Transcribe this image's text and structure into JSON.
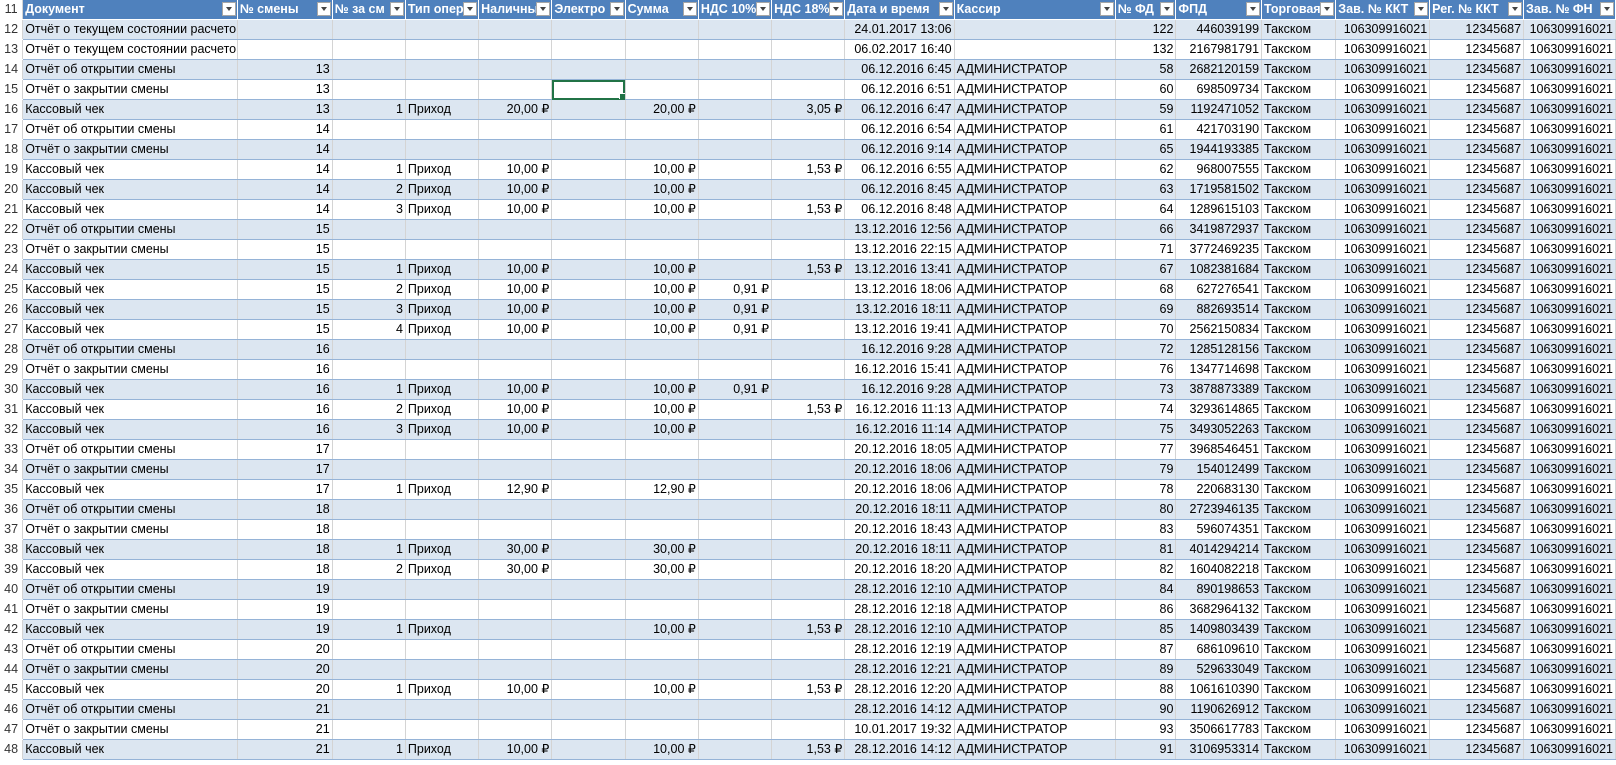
{
  "columns": [
    {
      "label": "Документ",
      "filter_icon": "filter-dropdown-icon"
    },
    {
      "label": "№ смены",
      "filter_icon": "filter-dropdown-icon"
    },
    {
      "label": "№ за см",
      "filter_icon": "filter-dropdown-icon"
    },
    {
      "label": "Тип опер",
      "filter_icon": "filter-dropdown-icon"
    },
    {
      "label": "Наличны",
      "filter_icon": "filter-dropdown-icon"
    },
    {
      "label": "Электро",
      "filter_icon": "filter-dropdown-icon"
    },
    {
      "label": "Сумма",
      "filter_icon": "filter-dropdown-icon"
    },
    {
      "label": "НДС 10%",
      "filter_icon": "filter-dropdown-icon"
    },
    {
      "label": "НДС 18%",
      "filter_icon": "filter-dropdown-icon"
    },
    {
      "label": "Дата и время",
      "filter_icon": "filter-dropdown-icon"
    },
    {
      "label": "Кассир",
      "filter_icon": "filter-dropdown-icon"
    },
    {
      "label": "№ ФД",
      "filter_icon": "filter-dropdown-icon"
    },
    {
      "label": "ФПД",
      "filter_icon": "filter-dropdown-icon"
    },
    {
      "label": "Торговая",
      "filter_icon": "filter-dropdown-icon"
    },
    {
      "label": "Зав. № ККТ",
      "filter_icon": "filter-dropdown-icon"
    },
    {
      "label": "Рег. № ККТ",
      "filter_icon": "filter-dropdown-icon"
    },
    {
      "label": "Зав. № ФН",
      "filter_icon": "filter-dropdown-icon"
    }
  ],
  "header_row_number": "11",
  "selected_cell": {
    "row": "15",
    "column": "Электро"
  },
  "colors": {
    "header_bg": "#4f81bd",
    "band_bg": "#dce6f1",
    "selection": "#217346"
  },
  "rows": [
    {
      "n": "12",
      "cells": [
        "Отчёт о текущем состоянии расчетов",
        "",
        "",
        "",
        "",
        "",
        "",
        "",
        "",
        "24.01.2017 13:06",
        "",
        "122",
        "446039199",
        "Такском",
        "106309916021",
        "12345687",
        "106309916021"
      ]
    },
    {
      "n": "13",
      "cells": [
        "Отчёт о текущем состоянии расчетов",
        "",
        "",
        "",
        "",
        "",
        "",
        "",
        "",
        "06.02.2017 16:40",
        "",
        "132",
        "2167981791",
        "Такском",
        "106309916021",
        "12345687",
        "106309916021"
      ]
    },
    {
      "n": "14",
      "cells": [
        "Отчёт об открытии смены",
        "13",
        "",
        "",
        "",
        "",
        "",
        "",
        "",
        "06.12.2016 6:45",
        "АДМИНИСТРАТОР",
        "58",
        "2682120159",
        "Такском",
        "106309916021",
        "12345687",
        "106309916021"
      ]
    },
    {
      "n": "15",
      "cells": [
        "Отчёт о закрытии смены",
        "13",
        "",
        "",
        "",
        "",
        "",
        "",
        "",
        "06.12.2016 6:51",
        "АДМИНИСТРАТОР",
        "60",
        "698509734",
        "Такском",
        "106309916021",
        "12345687",
        "106309916021"
      ]
    },
    {
      "n": "16",
      "cells": [
        "Кассовый чек",
        "13",
        "1",
        "Приход",
        "20,00 ₽",
        "",
        "20,00 ₽",
        "",
        "3,05 ₽",
        "06.12.2016 6:47",
        "АДМИНИСТРАТОР",
        "59",
        "1192471052",
        "Такском",
        "106309916021",
        "12345687",
        "106309916021"
      ]
    },
    {
      "n": "17",
      "cells": [
        "Отчёт об открытии смены",
        "14",
        "",
        "",
        "",
        "",
        "",
        "",
        "",
        "06.12.2016 6:54",
        "АДМИНИСТРАТОР",
        "61",
        "421703190",
        "Такском",
        "106309916021",
        "12345687",
        "106309916021"
      ]
    },
    {
      "n": "18",
      "cells": [
        "Отчёт о закрытии смены",
        "14",
        "",
        "",
        "",
        "",
        "",
        "",
        "",
        "06.12.2016 9:14",
        "АДМИНИСТРАТОР",
        "65",
        "1944193385",
        "Такском",
        "106309916021",
        "12345687",
        "106309916021"
      ]
    },
    {
      "n": "19",
      "cells": [
        "Кассовый чек",
        "14",
        "1",
        "Приход",
        "10,00 ₽",
        "",
        "10,00 ₽",
        "",
        "1,53 ₽",
        "06.12.2016 6:55",
        "АДМИНИСТРАТОР",
        "62",
        "968007555",
        "Такском",
        "106309916021",
        "12345687",
        "106309916021"
      ]
    },
    {
      "n": "20",
      "cells": [
        "Кассовый чек",
        "14",
        "2",
        "Приход",
        "10,00 ₽",
        "",
        "10,00 ₽",
        "",
        "",
        "06.12.2016 8:45",
        "АДМИНИСТРАТОР",
        "63",
        "1719581502",
        "Такском",
        "106309916021",
        "12345687",
        "106309916021"
      ]
    },
    {
      "n": "21",
      "cells": [
        "Кассовый чек",
        "14",
        "3",
        "Приход",
        "10,00 ₽",
        "",
        "10,00 ₽",
        "",
        "1,53 ₽",
        "06.12.2016 8:48",
        "АДМИНИСТРАТОР",
        "64",
        "1289615103",
        "Такском",
        "106309916021",
        "12345687",
        "106309916021"
      ]
    },
    {
      "n": "22",
      "cells": [
        "Отчёт об открытии смены",
        "15",
        "",
        "",
        "",
        "",
        "",
        "",
        "",
        "13.12.2016 12:56",
        "АДМИНИСТРАТОР",
        "66",
        "3419872937",
        "Такском",
        "106309916021",
        "12345687",
        "106309916021"
      ]
    },
    {
      "n": "23",
      "cells": [
        "Отчёт о закрытии смены",
        "15",
        "",
        "",
        "",
        "",
        "",
        "",
        "",
        "13.12.2016 22:15",
        "АДМИНИСТРАТОР",
        "71",
        "3772469235",
        "Такском",
        "106309916021",
        "12345687",
        "106309916021"
      ]
    },
    {
      "n": "24",
      "cells": [
        "Кассовый чек",
        "15",
        "1",
        "Приход",
        "10,00 ₽",
        "",
        "10,00 ₽",
        "",
        "1,53 ₽",
        "13.12.2016 13:41",
        "АДМИНИСТРАТОР",
        "67",
        "1082381684",
        "Такском",
        "106309916021",
        "12345687",
        "106309916021"
      ]
    },
    {
      "n": "25",
      "cells": [
        "Кассовый чек",
        "15",
        "2",
        "Приход",
        "10,00 ₽",
        "",
        "10,00 ₽",
        "0,91 ₽",
        "",
        "13.12.2016 18:06",
        "АДМИНИСТРАТОР",
        "68",
        "627276541",
        "Такском",
        "106309916021",
        "12345687",
        "106309916021"
      ]
    },
    {
      "n": "26",
      "cells": [
        "Кассовый чек",
        "15",
        "3",
        "Приход",
        "10,00 ₽",
        "",
        "10,00 ₽",
        "0,91 ₽",
        "",
        "13.12.2016 18:11",
        "АДМИНИСТРАТОР",
        "69",
        "882693514",
        "Такском",
        "106309916021",
        "12345687",
        "106309916021"
      ]
    },
    {
      "n": "27",
      "cells": [
        "Кассовый чек",
        "15",
        "4",
        "Приход",
        "10,00 ₽",
        "",
        "10,00 ₽",
        "0,91 ₽",
        "",
        "13.12.2016 19:41",
        "АДМИНИСТРАТОР",
        "70",
        "2562150834",
        "Такском",
        "106309916021",
        "12345687",
        "106309916021"
      ]
    },
    {
      "n": "28",
      "cells": [
        "Отчёт об открытии смены",
        "16",
        "",
        "",
        "",
        "",
        "",
        "",
        "",
        "16.12.2016 9:28",
        "АДМИНИСТРАТОР",
        "72",
        "1285128156",
        "Такском",
        "106309916021",
        "12345687",
        "106309916021"
      ]
    },
    {
      "n": "29",
      "cells": [
        "Отчёт о закрытии смены",
        "16",
        "",
        "",
        "",
        "",
        "",
        "",
        "",
        "16.12.2016 15:41",
        "АДМИНИСТРАТОР",
        "76",
        "1347714698",
        "Такском",
        "106309916021",
        "12345687",
        "106309916021"
      ]
    },
    {
      "n": "30",
      "cells": [
        "Кассовый чек",
        "16",
        "1",
        "Приход",
        "10,00 ₽",
        "",
        "10,00 ₽",
        "0,91 ₽",
        "",
        "16.12.2016 9:28",
        "АДМИНИСТРАТОР",
        "73",
        "3878873389",
        "Такском",
        "106309916021",
        "12345687",
        "106309916021"
      ]
    },
    {
      "n": "31",
      "cells": [
        "Кассовый чек",
        "16",
        "2",
        "Приход",
        "10,00 ₽",
        "",
        "10,00 ₽",
        "",
        "1,53 ₽",
        "16.12.2016 11:13",
        "АДМИНИСТРАТОР",
        "74",
        "3293614865",
        "Такском",
        "106309916021",
        "12345687",
        "106309916021"
      ]
    },
    {
      "n": "32",
      "cells": [
        "Кассовый чек",
        "16",
        "3",
        "Приход",
        "10,00 ₽",
        "",
        "10,00 ₽",
        "",
        "",
        "16.12.2016 11:14",
        "АДМИНИСТРАТОР",
        "75",
        "3493052263",
        "Такском",
        "106309916021",
        "12345687",
        "106309916021"
      ]
    },
    {
      "n": "33",
      "cells": [
        "Отчёт об открытии смены",
        "17",
        "",
        "",
        "",
        "",
        "",
        "",
        "",
        "20.12.2016 18:05",
        "АДМИНИСТРАТОР",
        "77",
        "3968546451",
        "Такском",
        "106309916021",
        "12345687",
        "106309916021"
      ]
    },
    {
      "n": "34",
      "cells": [
        "Отчёт о закрытии смены",
        "17",
        "",
        "",
        "",
        "",
        "",
        "",
        "",
        "20.12.2016 18:06",
        "АДМИНИСТРАТОР",
        "79",
        "154012499",
        "Такском",
        "106309916021",
        "12345687",
        "106309916021"
      ]
    },
    {
      "n": "35",
      "cells": [
        "Кассовый чек",
        "17",
        "1",
        "Приход",
        "12,90 ₽",
        "",
        "12,90 ₽",
        "",
        "",
        "20.12.2016 18:06",
        "АДМИНИСТРАТОР",
        "78",
        "220683130",
        "Такском",
        "106309916021",
        "12345687",
        "106309916021"
      ]
    },
    {
      "n": "36",
      "cells": [
        "Отчёт об открытии смены",
        "18",
        "",
        "",
        "",
        "",
        "",
        "",
        "",
        "20.12.2016 18:11",
        "АДМИНИСТРАТОР",
        "80",
        "2723946135",
        "Такском",
        "106309916021",
        "12345687",
        "106309916021"
      ]
    },
    {
      "n": "37",
      "cells": [
        "Отчёт о закрытии смены",
        "18",
        "",
        "",
        "",
        "",
        "",
        "",
        "",
        "20.12.2016 18:43",
        "АДМИНИСТРАТОР",
        "83",
        "596074351",
        "Такском",
        "106309916021",
        "12345687",
        "106309916021"
      ]
    },
    {
      "n": "38",
      "cells": [
        "Кассовый чек",
        "18",
        "1",
        "Приход",
        "30,00 ₽",
        "",
        "30,00 ₽",
        "",
        "",
        "20.12.2016 18:11",
        "АДМИНИСТРАТОР",
        "81",
        "4014294214",
        "Такском",
        "106309916021",
        "12345687",
        "106309916021"
      ]
    },
    {
      "n": "39",
      "cells": [
        "Кассовый чек",
        "18",
        "2",
        "Приход",
        "30,00 ₽",
        "",
        "30,00 ₽",
        "",
        "",
        "20.12.2016 18:20",
        "АДМИНИСТРАТОР",
        "82",
        "1604082218",
        "Такском",
        "106309916021",
        "12345687",
        "106309916021"
      ]
    },
    {
      "n": "40",
      "cells": [
        "Отчёт об открытии смены",
        "19",
        "",
        "",
        "",
        "",
        "",
        "",
        "",
        "28.12.2016 12:10",
        "АДМИНИСТРАТОР",
        "84",
        "890198653",
        "Такском",
        "106309916021",
        "12345687",
        "106309916021"
      ]
    },
    {
      "n": "41",
      "cells": [
        "Отчёт о закрытии смены",
        "19",
        "",
        "",
        "",
        "",
        "",
        "",
        "",
        "28.12.2016 12:18",
        "АДМИНИСТРАТОР",
        "86",
        "3682964132",
        "Такском",
        "106309916021",
        "12345687",
        "106309916021"
      ]
    },
    {
      "n": "42",
      "cells": [
        "Кассовый чек",
        "19",
        "1",
        "Приход",
        "",
        "",
        "10,00 ₽",
        "",
        "1,53 ₽",
        "28.12.2016 12:10",
        "АДМИНИСТРАТОР",
        "85",
        "1409803439",
        "Такском",
        "106309916021",
        "12345687",
        "106309916021"
      ]
    },
    {
      "n": "43",
      "cells": [
        "Отчёт об открытии смены",
        "20",
        "",
        "",
        "",
        "",
        "",
        "",
        "",
        "28.12.2016 12:19",
        "АДМИНИСТРАТОР",
        "87",
        "686109610",
        "Такском",
        "106309916021",
        "12345687",
        "106309916021"
      ]
    },
    {
      "n": "44",
      "cells": [
        "Отчёт о закрытии смены",
        "20",
        "",
        "",
        "",
        "",
        "",
        "",
        "",
        "28.12.2016 12:21",
        "АДМИНИСТРАТОР",
        "89",
        "529633049",
        "Такском",
        "106309916021",
        "12345687",
        "106309916021"
      ]
    },
    {
      "n": "45",
      "cells": [
        "Кассовый чек",
        "20",
        "1",
        "Приход",
        "10,00 ₽",
        "",
        "10,00 ₽",
        "",
        "1,53 ₽",
        "28.12.2016 12:20",
        "АДМИНИСТРАТОР",
        "88",
        "1061610390",
        "Такском",
        "106309916021",
        "12345687",
        "106309916021"
      ]
    },
    {
      "n": "46",
      "cells": [
        "Отчёт об открытии смены",
        "21",
        "",
        "",
        "",
        "",
        "",
        "",
        "",
        "28.12.2016 14:12",
        "АДМИНИСТРАТОР",
        "90",
        "1190626912",
        "Такском",
        "106309916021",
        "12345687",
        "106309916021"
      ]
    },
    {
      "n": "47",
      "cells": [
        "Отчёт о закрытии смены",
        "21",
        "",
        "",
        "",
        "",
        "",
        "",
        "",
        "10.01.2017 19:32",
        "АДМИНИСТРАТОР",
        "93",
        "3506617783",
        "Такском",
        "106309916021",
        "12345687",
        "106309916021"
      ]
    },
    {
      "n": "48",
      "cells": [
        "Кассовый чек",
        "21",
        "1",
        "Приход",
        "10,00 ₽",
        "",
        "10,00 ₽",
        "",
        "1,53 ₽",
        "28.12.2016 14:12",
        "АДМИНИСТРАТОР",
        "91",
        "3106953314",
        "Такском",
        "106309916021",
        "12345687",
        "106309916021"
      ]
    }
  ]
}
